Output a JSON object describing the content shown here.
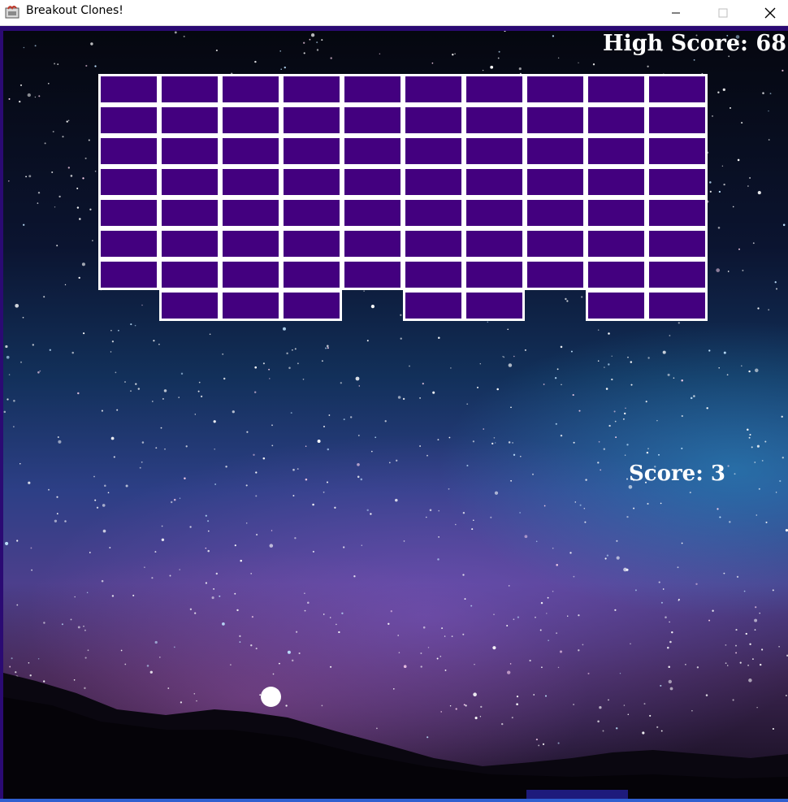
{
  "window": {
    "title": "Breakout Clones!",
    "controls": [
      "minimize",
      "maximize",
      "close"
    ]
  },
  "hud": {
    "high_score_text": "High Score: 68",
    "score_text": "Score: 3"
  },
  "bricks": {
    "columns": 10,
    "rows": 8,
    "color": "#43007f",
    "border_color": "#ffffff",
    "present": [
      [
        1,
        1,
        1,
        1,
        1,
        1,
        1,
        1,
        1,
        1
      ],
      [
        1,
        1,
        1,
        1,
        1,
        1,
        1,
        1,
        1,
        1
      ],
      [
        1,
        1,
        1,
        1,
        1,
        1,
        1,
        1,
        1,
        1
      ],
      [
        1,
        1,
        1,
        1,
        1,
        1,
        1,
        1,
        1,
        1
      ],
      [
        1,
        1,
        1,
        1,
        1,
        1,
        1,
        1,
        1,
        1
      ],
      [
        1,
        1,
        1,
        1,
        1,
        1,
        1,
        1,
        1,
        1
      ],
      [
        1,
        1,
        1,
        1,
        1,
        1,
        1,
        1,
        1,
        1
      ],
      [
        0,
        1,
        1,
        1,
        0,
        1,
        1,
        0,
        1,
        1
      ]
    ]
  },
  "colors": {
    "frame": "#2b0a73",
    "ball": "#ffffff",
    "paddle": "#1e1a7c",
    "text": "#ffffff"
  }
}
